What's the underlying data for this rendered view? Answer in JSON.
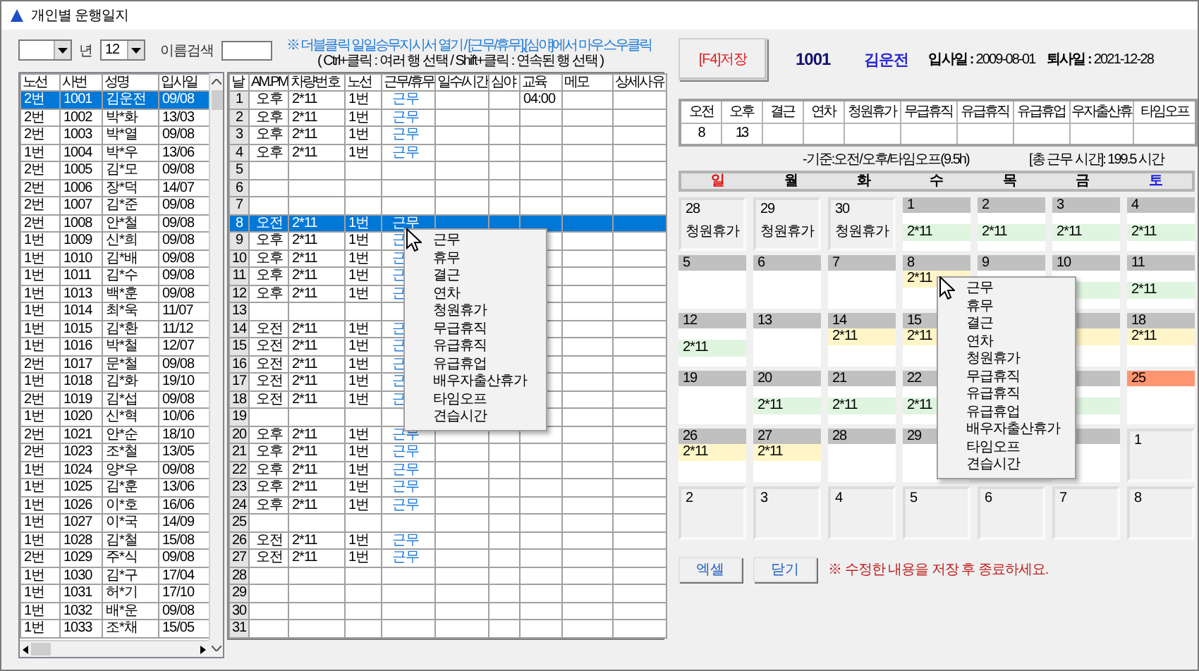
{
  "window": {
    "title": "개인별 운행일지"
  },
  "filters": {
    "year_label": "년",
    "month": "12",
    "search_label": "이름검색"
  },
  "employees": {
    "columns": [
      "노선",
      "사번",
      "성명",
      "입사일"
    ],
    "rows": [
      {
        "route": "2번",
        "id": "1001",
        "name": "김운전",
        "hired": "09/08",
        "selected": true
      },
      {
        "route": "2번",
        "id": "1002",
        "name": "박*화",
        "hired": "13/03",
        "selected": false
      },
      {
        "route": "2번",
        "id": "1003",
        "name": "박*열",
        "hired": "09/08",
        "selected": false
      },
      {
        "route": "1번",
        "id": "1004",
        "name": "박*우",
        "hired": "13/06",
        "selected": false
      },
      {
        "route": "2번",
        "id": "1005",
        "name": "김*모",
        "hired": "09/08",
        "selected": false
      },
      {
        "route": "2번",
        "id": "1006",
        "name": "장*덕",
        "hired": "14/07",
        "selected": false
      },
      {
        "route": "2번",
        "id": "1007",
        "name": "김*준",
        "hired": "09/08",
        "selected": false
      },
      {
        "route": "2번",
        "id": "1008",
        "name": "안*철",
        "hired": "09/08",
        "selected": false
      },
      {
        "route": "1번",
        "id": "1009",
        "name": "신*희",
        "hired": "09/08",
        "selected": false
      },
      {
        "route": "1번",
        "id": "1010",
        "name": "김*배",
        "hired": "09/08",
        "selected": false
      },
      {
        "route": "1번",
        "id": "1011",
        "name": "김*수",
        "hired": "09/08",
        "selected": false
      },
      {
        "route": "1번",
        "id": "1013",
        "name": "백*훈",
        "hired": "09/08",
        "selected": false
      },
      {
        "route": "1번",
        "id": "1014",
        "name": "최*욱",
        "hired": "11/07",
        "selected": false
      },
      {
        "route": "1번",
        "id": "1015",
        "name": "김*환",
        "hired": "11/12",
        "selected": false
      },
      {
        "route": "1번",
        "id": "1016",
        "name": "박*철",
        "hired": "12/07",
        "selected": false
      },
      {
        "route": "2번",
        "id": "1017",
        "name": "문*철",
        "hired": "09/08",
        "selected": false
      },
      {
        "route": "1번",
        "id": "1018",
        "name": "김*화",
        "hired": "19/10",
        "selected": false
      },
      {
        "route": "2번",
        "id": "1019",
        "name": "김*섭",
        "hired": "09/08",
        "selected": false
      },
      {
        "route": "1번",
        "id": "1020",
        "name": "신*혁",
        "hired": "10/06",
        "selected": false
      },
      {
        "route": "2번",
        "id": "1021",
        "name": "안*순",
        "hired": "18/10",
        "selected": false
      },
      {
        "route": "2번",
        "id": "1023",
        "name": "조*철",
        "hired": "13/05",
        "selected": false
      },
      {
        "route": "1번",
        "id": "1024",
        "name": "양*우",
        "hired": "09/08",
        "selected": false
      },
      {
        "route": "1번",
        "id": "1025",
        "name": "김*훈",
        "hired": "13/06",
        "selected": false
      },
      {
        "route": "1번",
        "id": "1026",
        "name": "이*호",
        "hired": "16/06",
        "selected": false
      },
      {
        "route": "1번",
        "id": "1027",
        "name": "이*국",
        "hired": "14/09",
        "selected": false
      },
      {
        "route": "1번",
        "id": "1028",
        "name": "김*철",
        "hired": "15/08",
        "selected": false
      },
      {
        "route": "2번",
        "id": "1029",
        "name": "주*식",
        "hired": "09/08",
        "selected": false
      },
      {
        "route": "1번",
        "id": "1030",
        "name": "김*구",
        "hired": "17/04",
        "selected": false
      },
      {
        "route": "1번",
        "id": "1031",
        "name": "허*기",
        "hired": "17/10",
        "selected": false
      },
      {
        "route": "1번",
        "id": "1032",
        "name": "배*운",
        "hired": "09/08",
        "selected": false
      },
      {
        "route": "1번",
        "id": "1033",
        "name": "조*채",
        "hired": "15/05",
        "selected": false
      }
    ]
  },
  "hint": "※ 더블클릭 일일승무지시서 열기 / [근무/휴무],[심야]에서 마우스우클릭",
  "help": "( Ctrl+클릭 : 여러 행 선택 / Shift+클릭 : 연속된 행 선택 )",
  "daily_log": {
    "columns": [
      "날",
      "AM.PM",
      "차량번호",
      "노선",
      "근무/휴무",
      "일수/시간",
      "심야",
      "교육",
      "메모",
      "상세사유"
    ],
    "rows": [
      {
        "day": "1",
        "ampm": "오후",
        "vehicle": "2*11",
        "route": "1번",
        "status": "근무",
        "education": "04:00",
        "selected": false
      },
      {
        "day": "2",
        "ampm": "오후",
        "vehicle": "2*11",
        "route": "1번",
        "status": "근무",
        "selected": false
      },
      {
        "day": "3",
        "ampm": "오후",
        "vehicle": "2*11",
        "route": "1번",
        "status": "근무",
        "selected": false
      },
      {
        "day": "4",
        "ampm": "오후",
        "vehicle": "2*11",
        "route": "1번",
        "status": "근무",
        "selected": false
      },
      {
        "day": "5",
        "selected": false
      },
      {
        "day": "6",
        "selected": false
      },
      {
        "day": "7",
        "selected": false
      },
      {
        "day": "8",
        "ampm": "오전",
        "vehicle": "2*11",
        "route": "1번",
        "status": "근무",
        "selected": true
      },
      {
        "day": "9",
        "ampm": "오후",
        "vehicle": "2*11",
        "route": "1번",
        "status": "근",
        "selected": false
      },
      {
        "day": "10",
        "ampm": "오후",
        "vehicle": "2*11",
        "route": "1번",
        "status": "근",
        "selected": false
      },
      {
        "day": "11",
        "ampm": "오후",
        "vehicle": "2*11",
        "route": "1번",
        "status": "근",
        "selected": false
      },
      {
        "day": "12",
        "ampm": "오후",
        "vehicle": "2*11",
        "route": "1번",
        "status": "근",
        "selected": false
      },
      {
        "day": "13",
        "selected": false
      },
      {
        "day": "14",
        "ampm": "오전",
        "vehicle": "2*11",
        "route": "1번",
        "status": "근",
        "selected": false
      },
      {
        "day": "15",
        "ampm": "오전",
        "vehicle": "2*11",
        "route": "1번",
        "status": "근",
        "selected": false
      },
      {
        "day": "16",
        "ampm": "오전",
        "vehicle": "2*11",
        "route": "1번",
        "status": "근",
        "selected": false
      },
      {
        "day": "17",
        "ampm": "오전",
        "vehicle": "2*11",
        "route": "1번",
        "status": "근",
        "selected": false
      },
      {
        "day": "18",
        "ampm": "오전",
        "vehicle": "2*11",
        "route": "1번",
        "status": "근",
        "selected": false
      },
      {
        "day": "19",
        "selected": false
      },
      {
        "day": "20",
        "ampm": "오후",
        "vehicle": "2*11",
        "route": "1번",
        "status": "근무",
        "selected": false
      },
      {
        "day": "21",
        "ampm": "오후",
        "vehicle": "2*11",
        "route": "1번",
        "status": "근무",
        "selected": false
      },
      {
        "day": "22",
        "ampm": "오후",
        "vehicle": "2*11",
        "route": "1번",
        "status": "근무",
        "selected": false
      },
      {
        "day": "23",
        "ampm": "오후",
        "vehicle": "2*11",
        "route": "1번",
        "status": "근무",
        "selected": false
      },
      {
        "day": "24",
        "ampm": "오후",
        "vehicle": "2*11",
        "route": "1번",
        "status": "근무",
        "selected": false
      },
      {
        "day": "25",
        "selected": false
      },
      {
        "day": "26",
        "ampm": "오전",
        "vehicle": "2*11",
        "route": "1번",
        "status": "근무",
        "selected": false
      },
      {
        "day": "27",
        "ampm": "오전",
        "vehicle": "2*11",
        "route": "1번",
        "status": "근무",
        "selected": false
      },
      {
        "day": "28",
        "selected": false
      },
      {
        "day": "29",
        "selected": false
      },
      {
        "day": "30",
        "selected": false
      },
      {
        "day": "31",
        "selected": false
      }
    ]
  },
  "log_menu": {
    "items": [
      "근무",
      "휴무",
      "결근",
      "연차",
      "청원휴가",
      "무급휴직",
      "유급휴직",
      "유급휴업",
      "배우자출산휴가",
      "타임오프",
      "견습시간"
    ]
  },
  "save_button": "[F4]저장",
  "employee": {
    "id": "1001",
    "name": "김운전",
    "hired": "**입사일 :** 2009-08-01",
    "retired": "**퇴사일 :** 2021-12-28"
  },
  "summary": {
    "columns": [
      "오전",
      "오후",
      "결근",
      "연차",
      "청원휴가",
      "무급휴직",
      "유급휴직",
      "유급휴업",
      "우자출산휴",
      "타임오프"
    ],
    "values": [
      "8",
      "13"
    ]
  },
  "basis_note": "-기준:오전/오후/타임오프(9.5h)",
  "total_hours": "[총 근무 시간]: 199.5 시간",
  "weekdays": [
    {
      "label": "일",
      "kind": "sunday"
    },
    {
      "label": "월",
      "kind": "weekday"
    },
    {
      "label": "화",
      "kind": "weekday"
    },
    {
      "label": "수",
      "kind": "weekday"
    },
    {
      "label": "목",
      "kind": "weekday"
    },
    {
      "label": "금",
      "kind": "weekday"
    },
    {
      "label": "토",
      "kind": "saturday"
    }
  ],
  "calendar": {
    "weeks": [
      [
        {
          "kind": "other",
          "day": "28",
          "note": "청원휴가"
        },
        {
          "kind": "other",
          "day": "29",
          "note": "청원휴가"
        },
        {
          "kind": "other",
          "day": "30",
          "note": "청원휴가"
        },
        {
          "kind": "current",
          "day": "1",
          "morning_shift": false,
          "entry": "2*11"
        },
        {
          "kind": "current",
          "day": "2",
          "morning_shift": false,
          "entry": "2*11"
        },
        {
          "kind": "current",
          "day": "3",
          "morning_shift": false,
          "entry": "2*11"
        },
        {
          "kind": "current",
          "day": "4",
          "morning_shift": false,
          "entry": "2*11"
        }
      ],
      [
        {
          "kind": "current",
          "day": "5"
        },
        {
          "kind": "current",
          "day": "6"
        },
        {
          "kind": "current",
          "day": "7"
        },
        {
          "kind": "current",
          "day": "8",
          "morning_shift": true,
          "entry": "2*11"
        },
        {
          "kind": "current",
          "day": "9"
        },
        {
          "kind": "current",
          "day": "10",
          "morning_shift": false
        },
        {
          "kind": "current",
          "day": "11",
          "morning_shift": false,
          "entry": "2*11"
        }
      ],
      [
        {
          "kind": "current",
          "day": "12",
          "morning_shift": false,
          "entry": "2*11"
        },
        {
          "kind": "current",
          "day": "13"
        },
        {
          "kind": "current",
          "day": "14",
          "morning_shift": true,
          "entry": "2*11"
        },
        {
          "kind": "current",
          "day": "15",
          "morning_shift": true,
          "entry": "2*11"
        },
        {
          "kind": "covered"
        },
        {
          "kind": "current",
          "morning_shift": true
        },
        {
          "kind": "current",
          "day": "18",
          "morning_shift": true,
          "entry": "2*11"
        }
      ],
      [
        {
          "kind": "current",
          "day": "19"
        },
        {
          "kind": "current",
          "day": "20",
          "morning_shift": false,
          "entry": "2*11"
        },
        {
          "kind": "current",
          "day": "21",
          "morning_shift": false,
          "entry": "2*11"
        },
        {
          "kind": "current",
          "day": "22",
          "morning_shift": false,
          "entry": "2*11"
        },
        {
          "kind": "covered"
        },
        {
          "kind": "current",
          "morning_shift": false
        },
        {
          "kind": "current",
          "day": "25",
          "holiday": true
        }
      ],
      [
        {
          "kind": "current",
          "day": "26",
          "morning_shift": true,
          "entry": "2*11"
        },
        {
          "kind": "current",
          "day": "27",
          "morning_shift": true,
          "entry": "2*11"
        },
        {
          "kind": "current",
          "day": "28"
        },
        {
          "kind": "current",
          "day": "29"
        },
        {
          "kind": "covered"
        },
        {
          "kind": "current"
        },
        {
          "kind": "other",
          "day": "1"
        }
      ],
      [
        {
          "kind": "other",
          "day": "2"
        },
        {
          "kind": "other",
          "day": "3"
        },
        {
          "kind": "other",
          "day": "4"
        },
        {
          "kind": "other",
          "day": "5"
        },
        {
          "kind": "other",
          "day": "6"
        },
        {
          "kind": "other",
          "day": "7"
        },
        {
          "kind": "other",
          "day": "8"
        }
      ]
    ]
  },
  "calendar_menu": {
    "items": [
      "근무",
      "휴무",
      "결근",
      "연차",
      "청원휴가",
      "무급휴직",
      "유급휴직",
      "유급휴업",
      "배우자출산휴가",
      "타임오프",
      "견습시간"
    ]
  },
  "buttons": [
    "엑셀",
    "닫기"
  ],
  "warning": "※ 수정한 내용을 저장 후 종료하세요."
}
